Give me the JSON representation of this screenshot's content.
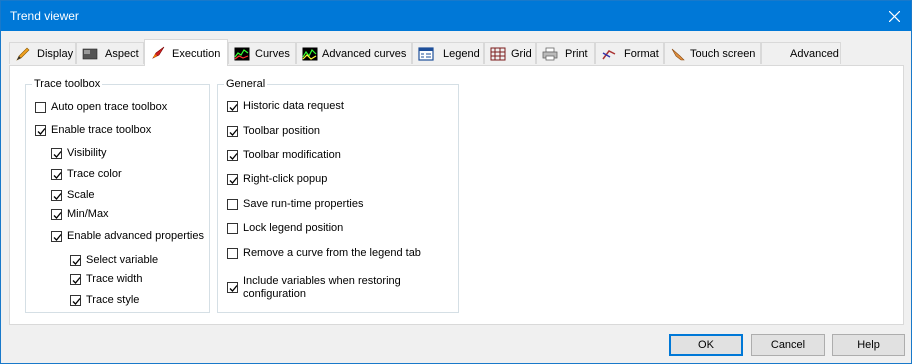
{
  "window": {
    "title": "Trend viewer",
    "close_label": "×"
  },
  "tabs": [
    {
      "label": "Display",
      "icon": "pencil-icon"
    },
    {
      "label": "Aspect",
      "icon": "aspect-icon"
    },
    {
      "label": "Execution",
      "icon": "rocket-icon",
      "active": true
    },
    {
      "label": "Curves",
      "icon": "curves-icon"
    },
    {
      "label": "Advanced curves",
      "icon": "advanced-curves-icon"
    },
    {
      "label": "Legend",
      "icon": "legend-icon"
    },
    {
      "label": "Grid",
      "icon": "grid-icon"
    },
    {
      "label": "Print",
      "icon": "printer-icon"
    },
    {
      "label": "Format",
      "icon": "format-icon"
    },
    {
      "label": "Touch screen",
      "icon": "touch-icon"
    },
    {
      "label": "Advanced",
      "icon": ""
    }
  ],
  "trace_toolbox": {
    "title": "Trace toolbox",
    "items": [
      {
        "label": "Auto open trace toolbox",
        "checked": false
      },
      {
        "label": "Enable trace toolbox",
        "checked": true
      },
      {
        "label": "Visibility",
        "checked": true
      },
      {
        "label": "Trace color",
        "checked": true
      },
      {
        "label": "Scale",
        "checked": true
      },
      {
        "label": "Min/Max",
        "checked": true
      },
      {
        "label": "Enable advanced properties",
        "checked": true
      },
      {
        "label": "Select variable",
        "checked": true
      },
      {
        "label": "Trace width",
        "checked": true
      },
      {
        "label": "Trace style",
        "checked": true
      }
    ]
  },
  "general": {
    "title": "General",
    "items": [
      {
        "label": "Historic data request",
        "checked": true
      },
      {
        "label": "Toolbar position",
        "checked": true
      },
      {
        "label": "Toolbar modification",
        "checked": true
      },
      {
        "label": "Right-click popup",
        "checked": true
      },
      {
        "label": "Save run-time properties",
        "checked": false
      },
      {
        "label": "Lock legend position",
        "checked": false
      },
      {
        "label": "Remove a curve from the legend tab",
        "checked": false
      },
      {
        "label": "Include variables when restoring",
        "label2": "configuration",
        "checked": true
      }
    ]
  },
  "buttons": {
    "ok": "OK",
    "cancel": "Cancel",
    "help": "Help"
  }
}
